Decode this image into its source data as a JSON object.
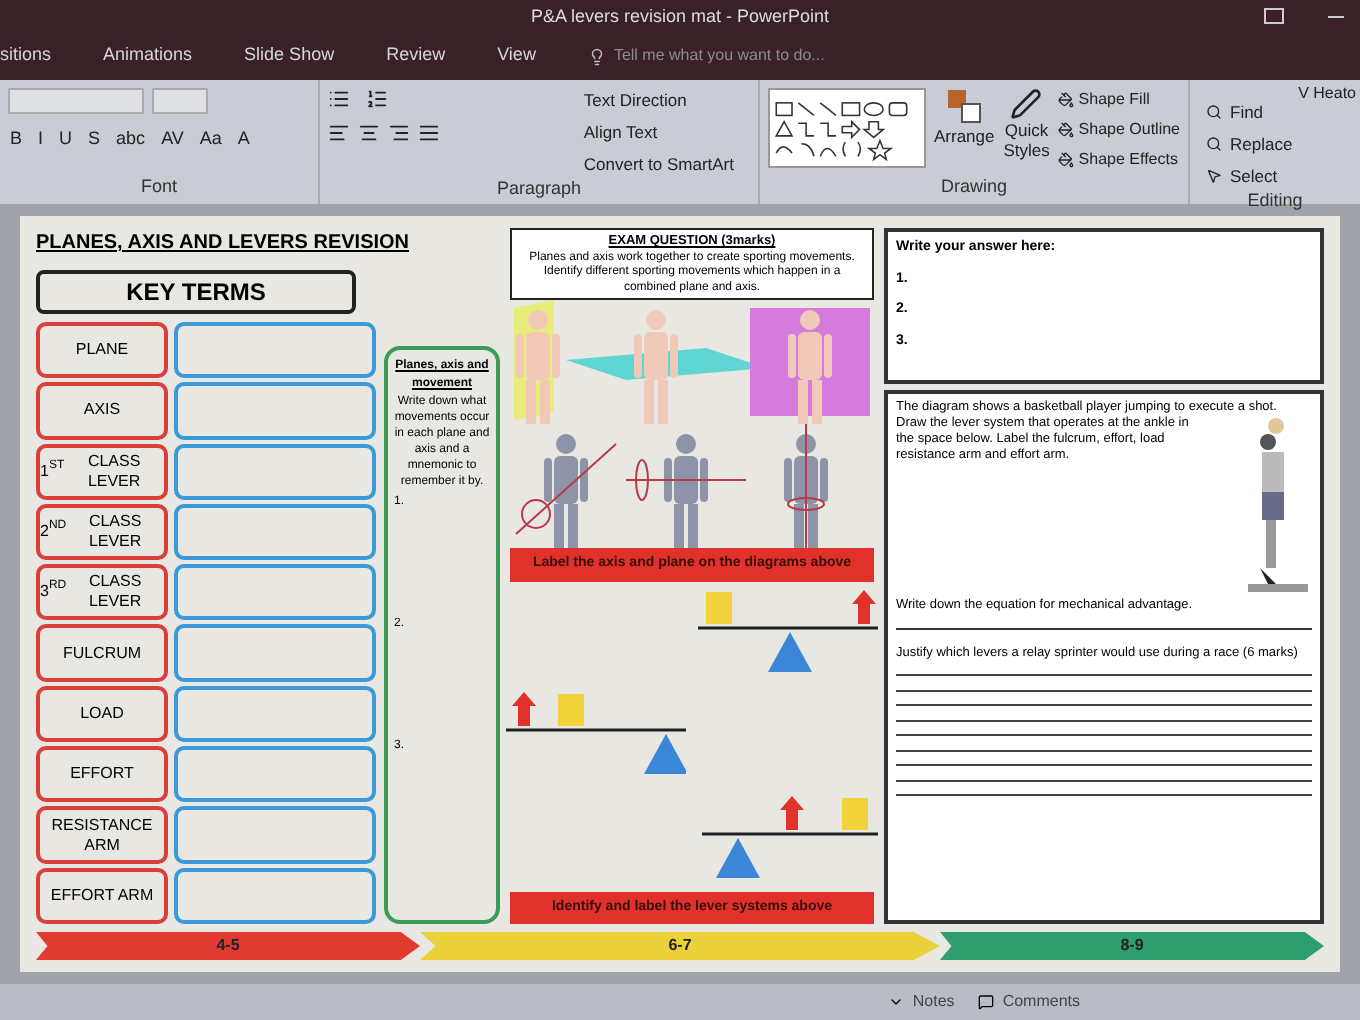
{
  "window": {
    "title": "P&A levers revision mat - PowerPoint",
    "user": "V Heato"
  },
  "tabs": [
    {
      "label": "sitions",
      "selected": false
    },
    {
      "label": "Animations",
      "selected": false
    },
    {
      "label": "Slide Show",
      "selected": false
    },
    {
      "label": "Review",
      "selected": false
    },
    {
      "label": "View",
      "selected": false
    }
  ],
  "tell_me": {
    "placeholder": "Tell me what you want to do..."
  },
  "ribbon": {
    "font": {
      "label": "Font",
      "buttons": [
        "B",
        "I",
        "U",
        "S",
        "abc",
        "AV",
        "Aa",
        "A"
      ]
    },
    "paragraph": {
      "label": "Paragraph",
      "buttons": [
        "Text Direction",
        "Align Text",
        "Convert to SmartArt"
      ]
    },
    "drawing": {
      "label": "Drawing",
      "buttons": [
        "Arrange",
        "Quick Styles",
        "Shape Fill",
        "Shape Outline",
        "Shape Effects"
      ]
    },
    "editing": {
      "label": "Editing",
      "buttons": [
        "Find",
        "Replace",
        "Select"
      ]
    }
  },
  "slide": {
    "title": "PLANES, AXIS AND LEVERS REVISION",
    "key_terms_heading": "KEY TERMS",
    "terms": [
      "PLANE",
      "AXIS",
      "1$^{ST}$ CLASS LEVER",
      "2$^{ND}$ CLASS LEVER",
      "3$^{RD}$ CLASS LEVER",
      "FULCRUM",
      "LOAD",
      "EFFORT",
      "RESISTANCE ARM",
      "EFFORT ARM"
    ],
    "movement_box": {
      "heading": "Planes, axis and movement",
      "body": "Write down what movements occur in each plane and axis and a mnemonic to remember it by.",
      "numbers": [
        "1.",
        "2.",
        "3."
      ]
    },
    "exam_question": {
      "heading": "EXAM QUESTION (3marks)",
      "body": "Planes and axis work together to create sporting movements. Identify different sporting movements which happen in a combined plane and axis."
    },
    "axis_banner": "Label the axis and plane on the diagrams above",
    "lever_banner": "Identify and label the lever systems above",
    "answer_box": {
      "heading": "Write your answer here:",
      "numbers": [
        "1.",
        "2.",
        "3."
      ]
    },
    "ankle_question": {
      "intro": "The diagram shows a basketball player jumping to execute a shot.",
      "task": "Draw the lever system that operates at the ankle in the space below. Label the fulcrum, effort, load resistance arm and effort arm."
    },
    "equation_prompt": "Write down the equation for mechanical advantage.",
    "justify_prompt": "Justify which levers a relay sprinter would use during a race (6 marks)",
    "grade_bands": [
      {
        "label": "4-5",
        "color": "#e03a31"
      },
      {
        "label": "6-7",
        "color": "#ecd23a"
      },
      {
        "label": "8-9",
        "color": "#2e9e6e"
      }
    ]
  },
  "status_bar": {
    "buttons": [
      "Notes",
      "Comments"
    ]
  }
}
